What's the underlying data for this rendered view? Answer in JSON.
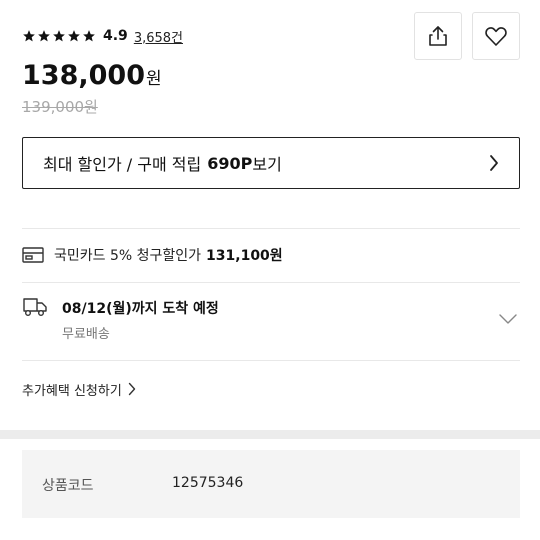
{
  "rating": {
    "stars": 5,
    "score": "4.9",
    "review_count": "3,658건"
  },
  "actions": {
    "share_icon": "share-icon",
    "wish_icon": "heart-icon"
  },
  "price": {
    "value": "138,000",
    "unit": "원",
    "original": "139,000원"
  },
  "discount": {
    "text": "최대 할인가 / 구매 적립",
    "points": "690P",
    "view": "보기"
  },
  "card_benefit": {
    "text": "국민카드 5% 청구할인가",
    "amount": "131,100원"
  },
  "delivery": {
    "title": "08/12(월)까지 도착 예정",
    "subtitle": "무료배송"
  },
  "extra_benefit": {
    "label": "추가혜택 신청하기"
  },
  "product_info": {
    "code_label": "상품코드",
    "code_value": "12575346"
  },
  "colors": {
    "text": "#111111",
    "muted": "#a8a8a8",
    "divider": "#e8e8e8",
    "panel": "#f4f4f4"
  }
}
